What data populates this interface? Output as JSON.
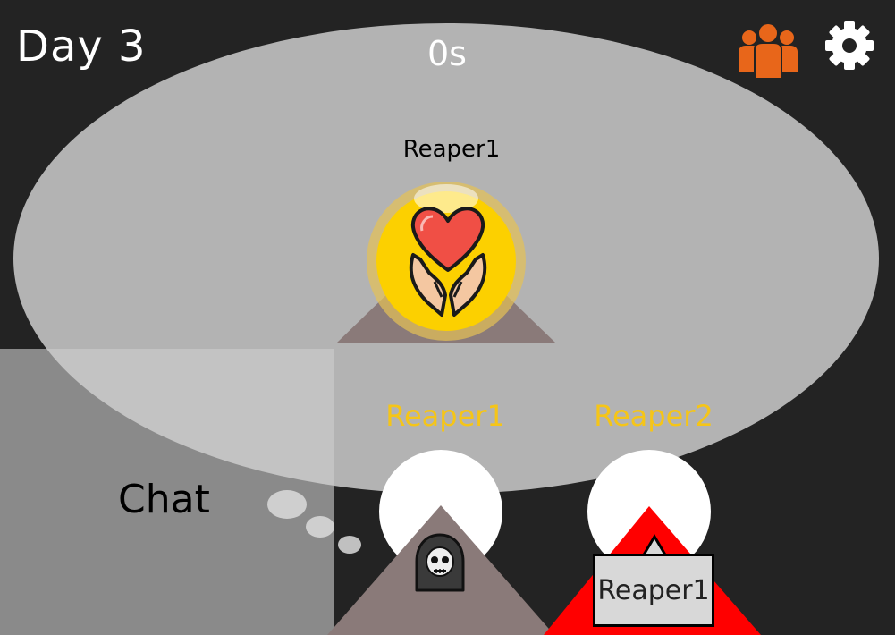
{
  "hud": {
    "day_label": "Day 3",
    "timer": "0s",
    "players_icon": "group-icon",
    "settings_icon": "gear-icon"
  },
  "colors": {
    "background": "#232323",
    "bubble": "#c4c4c4",
    "chat_panel": "#8a8a8a",
    "player_name": "#f5c518",
    "players_icon": "#e8661a",
    "pedestal": "#8a7a79",
    "target_highlight": "#ff0000"
  },
  "thought_bubble": {
    "speaker": "Reaper1",
    "action_icon": "heart-in-hands-icon"
  },
  "chat": {
    "label": "Chat"
  },
  "players": [
    {
      "name": "Reaper1",
      "avatar_icon": "grim-reaper-icon",
      "role": "self"
    },
    {
      "name": "Reaper2",
      "avatar_icon": "",
      "role": "targeted"
    }
  ],
  "target_label": {
    "text": "Reaper1"
  }
}
